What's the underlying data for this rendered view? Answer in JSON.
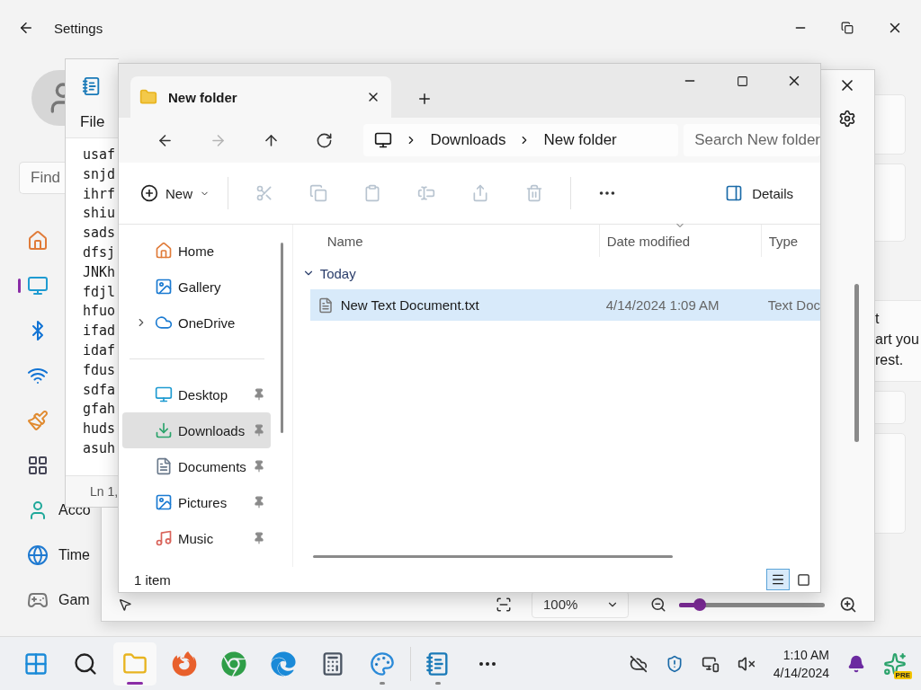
{
  "settings": {
    "title": "Settings",
    "search_placeholder": "Find",
    "nav": [
      {
        "kind": "home",
        "selected": false
      },
      {
        "kind": "system",
        "selected": true
      },
      {
        "kind": "bluetooth",
        "selected": false
      },
      {
        "kind": "network",
        "selected": false
      },
      {
        "kind": "personalization",
        "selected": false
      },
      {
        "kind": "apps",
        "selected": false
      },
      {
        "kind": "accounts",
        "label": "Acco",
        "selected": false
      },
      {
        "kind": "time",
        "label": "Time",
        "selected": false
      },
      {
        "kind": "gaming",
        "label": "Gam",
        "selected": false
      }
    ],
    "content": [
      "t",
      "art you",
      "rest."
    ]
  },
  "back_window": {
    "zoom": "100%",
    "zoom_slider": {
      "level": 0.14
    }
  },
  "notepad": {
    "menu": "File",
    "lines": [
      "usaf",
      "snjd",
      "ihrf",
      "shiu",
      "sads",
      "dfsj",
      "JNKh",
      "fdjl",
      "hfuo",
      "ifad",
      "idaf",
      "fdus",
      "sdfa",
      "gfah",
      "huds",
      "asuh"
    ],
    "status": "Ln 1,"
  },
  "explorer": {
    "tab": "New folder",
    "nav_buttons": [
      {
        "kind": "back",
        "disabled": false
      },
      {
        "kind": "forward",
        "disabled": true
      },
      {
        "kind": "up",
        "disabled": false
      },
      {
        "kind": "refresh",
        "disabled": false
      }
    ],
    "breadcrumb": [
      "Downloads",
      "New folder"
    ],
    "search_placeholder": "Search New folder",
    "new_label": "New",
    "actions": [
      {
        "kind": "cut",
        "disabled": true
      },
      {
        "kind": "copy",
        "disabled": true
      },
      {
        "kind": "paste",
        "disabled": true
      },
      {
        "kind": "rename",
        "disabled": true
      },
      {
        "kind": "share",
        "disabled": true
      },
      {
        "kind": "delete",
        "disabled": true
      }
    ],
    "details_label": "Details",
    "nav": [
      {
        "kind": "home",
        "label": "Home",
        "selected": false,
        "pinned": false,
        "expandable": false
      },
      {
        "kind": "gallery",
        "label": "Gallery",
        "selected": false,
        "pinned": false,
        "expandable": false
      },
      {
        "kind": "onedrive",
        "label": "OneDrive",
        "selected": false,
        "pinned": false,
        "expandable": true
      },
      {
        "kind": "divider"
      },
      {
        "kind": "desktop",
        "label": "Desktop",
        "selected": false,
        "pinned": true,
        "expandable": false
      },
      {
        "kind": "downloads",
        "label": "Downloads",
        "selected": true,
        "pinned": true,
        "expandable": false
      },
      {
        "kind": "documents",
        "label": "Documents",
        "selected": false,
        "pinned": true,
        "expandable": false
      },
      {
        "kind": "pictures",
        "label": "Pictures",
        "selected": false,
        "pinned": true,
        "expandable": false
      },
      {
        "kind": "music",
        "label": "Music",
        "selected": false,
        "pinned": true,
        "expandable": false
      }
    ],
    "columns": [
      "Name",
      "Date modified",
      "Type"
    ],
    "group": "Today",
    "files": [
      {
        "name": "New Text Document.txt",
        "date": "4/14/2024 1:09 AM",
        "type": "Text Doc",
        "selected": true
      }
    ],
    "status": "1 item",
    "views": [
      {
        "kind": "details",
        "selected": true
      },
      {
        "kind": "tiles",
        "selected": false
      }
    ]
  },
  "taskbar": {
    "apps": [
      {
        "kind": "start",
        "selected": false,
        "running": false
      },
      {
        "kind": "search",
        "selected": false,
        "running": false
      },
      {
        "kind": "explorer",
        "selected": true,
        "running": true
      },
      {
        "kind": "firefox",
        "selected": false,
        "running": false
      },
      {
        "kind": "chrome",
        "selected": false,
        "running": false
      },
      {
        "kind": "edge",
        "selected": false,
        "running": false
      },
      {
        "kind": "calculator",
        "selected": false,
        "running": false
      },
      {
        "kind": "paint",
        "selected": false,
        "running": true
      },
      {
        "kind": "notepad",
        "selected": false,
        "running": true
      },
      {
        "kind": "more",
        "selected": false,
        "running": false
      }
    ],
    "time": "1:10 AM",
    "date": "4/14/2024",
    "copilot_badge": "PRE"
  }
}
